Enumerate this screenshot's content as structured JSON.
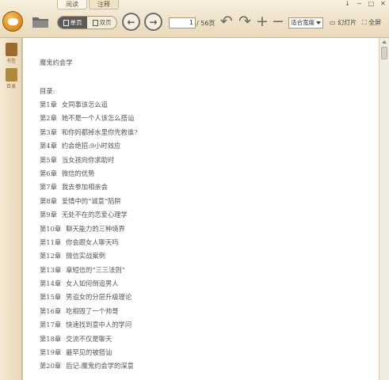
{
  "tabs": [
    "阅读",
    "注释"
  ],
  "system_buttons": [
    "↓",
    "─",
    "□",
    "✕"
  ],
  "view_modes": {
    "single": "单页",
    "double": "双页"
  },
  "navigation": {
    "current_page": "1",
    "total_label": "/ 56页"
  },
  "tools": {
    "undo": "↶",
    "redo": "↷",
    "zoom_in": "+",
    "zoom_out": "−"
  },
  "zoom": {
    "selected": "适合宽度"
  },
  "slideshow_label": "幻灯片",
  "fullscreen_label": "全屏",
  "sidebar": {
    "bookshelf": "书签",
    "toc": "目录"
  },
  "document": {
    "title": "魔鬼约会学",
    "toc_heading": "目录:",
    "chapters": [
      {
        "num": "第1章",
        "title": "女同事该怎么追"
      },
      {
        "num": "第2章",
        "title": "她不是一个人该怎么搭讪"
      },
      {
        "num": "第3章",
        "title": "和你妈都掉水里你先救谁?"
      },
      {
        "num": "第4章",
        "title": "约会绝招:9小时效应"
      },
      {
        "num": "第5章",
        "title": "当女孩向你求助时"
      },
      {
        "num": "第6章",
        "title": "微信的优势"
      },
      {
        "num": "第7章",
        "title": "我去参加相亲会"
      },
      {
        "num": "第8章",
        "title": "爱情中的“诚意”陷阱"
      },
      {
        "num": "第9章",
        "title": "无处不在的恋爱心理学"
      },
      {
        "num": "第10章",
        "title": "聊天能力的三种境界"
      },
      {
        "num": "第11章",
        "title": "你会跟女人聊天吗"
      },
      {
        "num": "第12章",
        "title": "微信实战案例"
      },
      {
        "num": "第13章",
        "title": "章短信的“三三法则”"
      },
      {
        "num": "第14章",
        "title": "女人如何倒追男人"
      },
      {
        "num": "第15章",
        "title": "男追女的分层升级理论"
      },
      {
        "num": "第16章",
        "title": "吃相毁了一个帅哥"
      },
      {
        "num": "第17章",
        "title": "快速找到意中人的学问"
      },
      {
        "num": "第18章",
        "title": "交流不仅是聊天"
      },
      {
        "num": "第19章",
        "title": "最罕见的被搭讪"
      },
      {
        "num": "第20章",
        "title": "后记:魔鬼约会学的深意"
      }
    ]
  }
}
